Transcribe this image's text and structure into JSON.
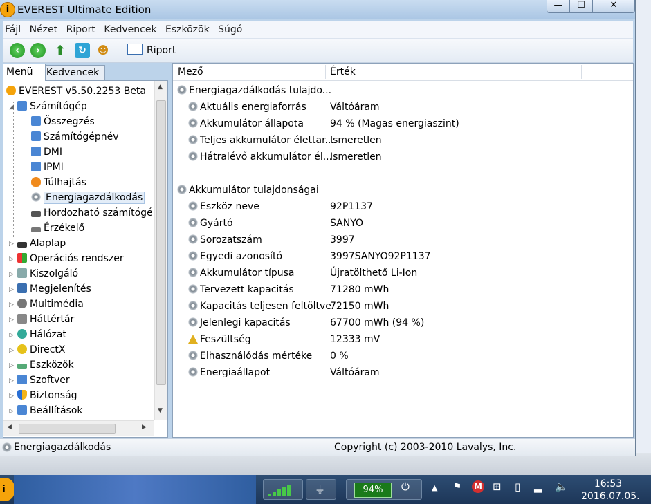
{
  "window": {
    "title": "EVEREST Ultimate Edition",
    "app_icon": "i"
  },
  "menubar": [
    "Fájl",
    "Nézet",
    "Riport",
    "Kedvencek",
    "Eszközök",
    "Súgó"
  ],
  "toolbar": {
    "report_label": "Riport"
  },
  "tabs": {
    "menu": "Menü",
    "favorites": "Kedvencek"
  },
  "tree": {
    "root": "EVEREST v5.50.2253 Beta",
    "computer": "Számítógép",
    "computer_children": [
      "Összegzés",
      "Számítógépnév",
      "DMI",
      "IPMI",
      "Túlhajtás",
      "Energiagazdálkodás",
      "Hordozható számítógé",
      "Érzékelő"
    ],
    "categories": [
      "Alaplap",
      "Operációs rendszer",
      "Kiszolgáló",
      "Megjelenítés",
      "Multimédia",
      "Háttértár",
      "Hálózat",
      "DirectX",
      "Eszközök",
      "Szoftver",
      "Biztonság",
      "Beállítások"
    ]
  },
  "columns": {
    "field": "Mező",
    "value": "Érték"
  },
  "sections": [
    {
      "title": "Energiagazdálkodás tulajdo...",
      "rows": [
        {
          "field": "Aktuális energiaforrás",
          "value": "Váltóáram",
          "icon": "gear-icon"
        },
        {
          "field": "Akkumulátor állapota",
          "value": "94 % (Magas energiaszint)",
          "icon": "gear-icon"
        },
        {
          "field": "Teljes akkumulátor élettar...",
          "value": "Ismeretlen",
          "icon": "gear-icon"
        },
        {
          "field": "Hátralévő akkumulátor él...",
          "value": "Ismeretlen",
          "icon": "gear-icon"
        }
      ]
    },
    {
      "title": "Akkumulátor tulajdonságai",
      "rows": [
        {
          "field": "Eszköz neve",
          "value": "92P1137",
          "icon": "gear-icon"
        },
        {
          "field": "Gyártó",
          "value": "SANYO",
          "icon": "gear-icon"
        },
        {
          "field": "Sorozatszám",
          "value": "3997",
          "icon": "gear-icon"
        },
        {
          "field": "Egyedi azonosító",
          "value": "3997SANYO92P1137",
          "icon": "gear-icon"
        },
        {
          "field": "Akkumulátor típusa",
          "value": "Újratölthető Li-Ion",
          "icon": "gear-icon"
        },
        {
          "field": "Tervezett kapacitás",
          "value": "71280 mWh",
          "icon": "gear-icon"
        },
        {
          "field": "Kapacitás teljesen feltöltve",
          "value": "72150 mWh",
          "icon": "gear-icon"
        },
        {
          "field": "Jelenlegi kapacitás",
          "value": "67700 mWh  (94 %)",
          "icon": "gear-icon"
        },
        {
          "field": "Feszültség",
          "value": "12333 mV",
          "icon": "warning-icon"
        },
        {
          "field": "Elhasználódás mértéke",
          "value": "0 %",
          "icon": "gear-icon"
        },
        {
          "field": "Energiaállapot",
          "value": "Váltóáram",
          "icon": "gear-icon"
        }
      ]
    }
  ],
  "status": {
    "left": "Energiagazdálkodás",
    "right": "Copyright (c) 2003-2010 Lavalys, Inc."
  },
  "taskbar": {
    "battery": "94%",
    "time": "16:53",
    "date": "2016.07.05."
  }
}
